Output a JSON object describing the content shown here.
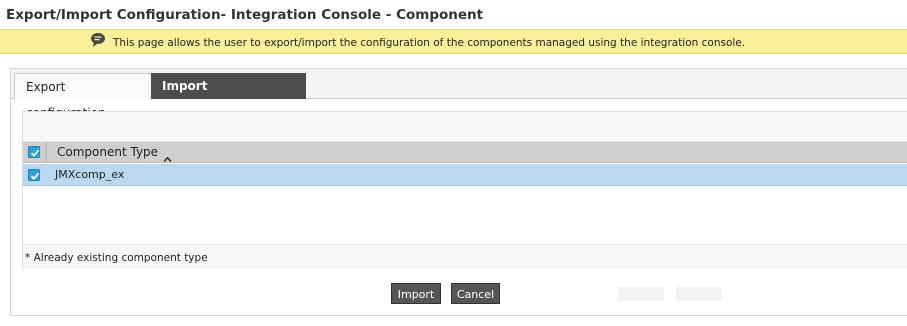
{
  "page": {
    "title": "Export/Import Configuration- Integration Console - Component"
  },
  "banner": {
    "icon": "speech-bubble-icon",
    "text": "This page allows the user to export/import the configuration of the components managed using the integration console."
  },
  "tabs": [
    {
      "label": "Export configuration",
      "active": false
    },
    {
      "label": "Import configuration",
      "active": true
    }
  ],
  "grid": {
    "select_all_checked": true,
    "columns": [
      {
        "label": "Component Type",
        "sort": "ascending",
        "sort_icon": "chevron-up-icon"
      }
    ],
    "rows": [
      {
        "label": "JMXcomp_ex",
        "checked": true,
        "selected": true
      }
    ],
    "footnote": "* Already existing component type"
  },
  "actions": {
    "import_label": "Import",
    "cancel_label": "Cancel"
  },
  "colors": {
    "banner_bg": "#fbf09a",
    "active_tab_bg": "#4d4d4d",
    "checkbox": "#2e9fd8",
    "selected_row": "#bad9f0",
    "button_bg": "#555555"
  }
}
